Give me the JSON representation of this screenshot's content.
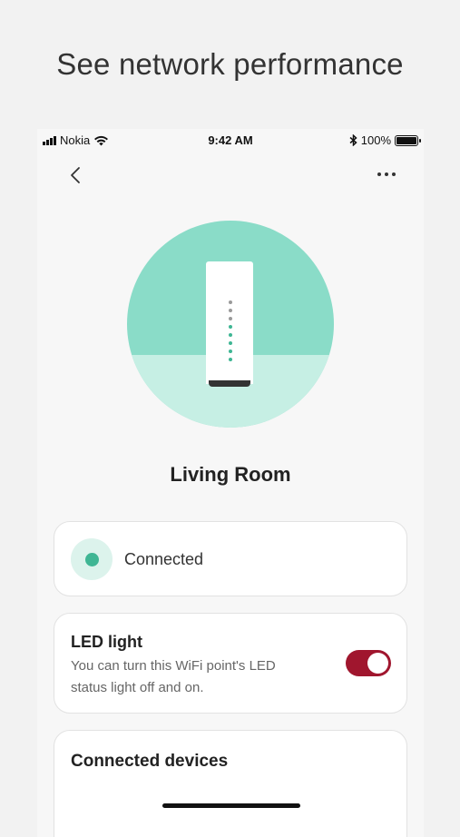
{
  "headline": "See network performance",
  "status_bar": {
    "carrier": "Nokia",
    "time": "9:42 AM",
    "battery": "100%",
    "icons": [
      "signal-icon",
      "wifi-icon",
      "bluetooth-icon",
      "battery-icon"
    ]
  },
  "nav": {
    "back_icon": "chevron-left-icon",
    "more_icon": "more-horizontal-icon"
  },
  "device": {
    "name": "Living Room",
    "led_dots": [
      "#9a9a9a",
      "#9a9a9a",
      "#9a9a9a",
      "#3fb694",
      "#3fb694",
      "#3fb694",
      "#3fb694",
      "#3fb694"
    ]
  },
  "status_card": {
    "label": "Connected",
    "color": "#3fb694"
  },
  "led_card": {
    "title": "LED light",
    "description": "You can turn this WiFi point's LED status light off and on.",
    "enabled": true,
    "toggle_color": "#a0162e"
  },
  "devices_card": {
    "title": "Connected devices"
  },
  "colors": {
    "circle_top": "#8adcc8",
    "circle_bottom": "#c6efe4",
    "accent": "#3fb694"
  }
}
